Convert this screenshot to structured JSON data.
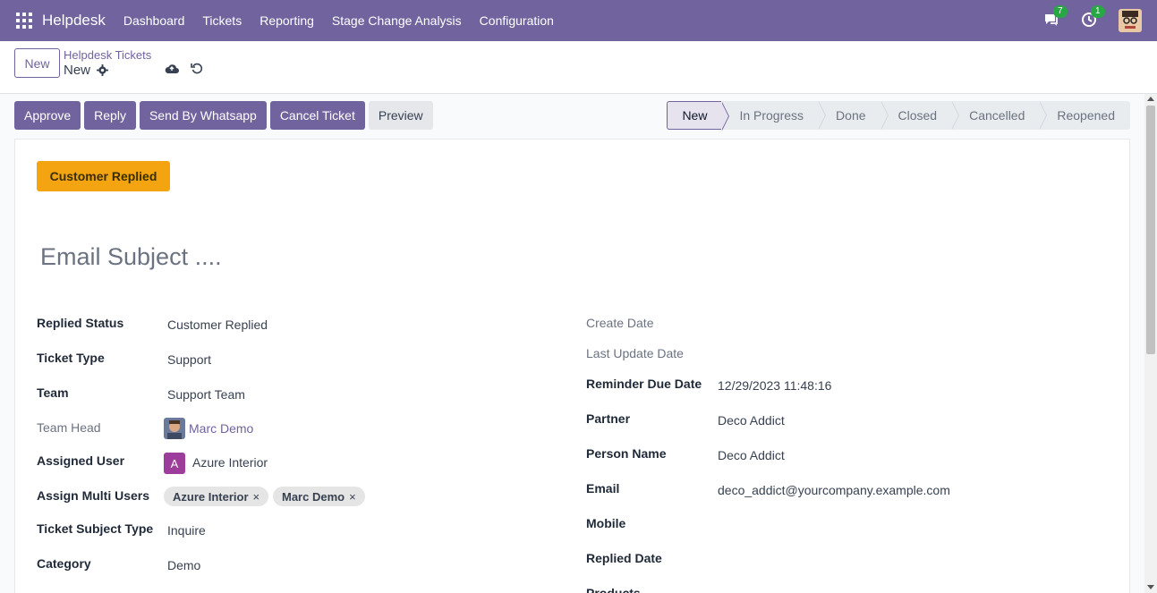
{
  "navbar": {
    "brand": "Helpdesk",
    "menu": [
      "Dashboard",
      "Tickets",
      "Reporting",
      "Stage Change Analysis",
      "Configuration"
    ],
    "messages_count": "7",
    "activities_count": "1",
    "accent_color": "#71639e"
  },
  "control": {
    "new_button": "New",
    "breadcrumb_parent": "Helpdesk Tickets",
    "breadcrumb_current": "New"
  },
  "statusbar": {
    "buttons": [
      "Approve",
      "Reply",
      "Send By Whatsapp",
      "Cancel Ticket",
      "Preview"
    ],
    "stages": [
      "New",
      "In Progress",
      "Done",
      "Closed",
      "Cancelled",
      "Reopened"
    ],
    "active_stage": "New"
  },
  "form": {
    "replied_badge": "Customer Replied",
    "subject_placeholder": "Email Subject ....",
    "left": {
      "replied_status": {
        "label": "Replied Status",
        "value": "Customer Replied"
      },
      "ticket_type": {
        "label": "Ticket Type",
        "value": "Support"
      },
      "team": {
        "label": "Team",
        "value": "Support Team"
      },
      "team_head": {
        "label": "Team Head",
        "value": "Marc Demo"
      },
      "assigned_user": {
        "label": "Assigned User",
        "value": "Azure Interior",
        "avatar_letter": "A"
      },
      "assign_multi_users": {
        "label": "Assign Multi Users",
        "tags": [
          "Azure Interior",
          "Marc Demo"
        ]
      },
      "ticket_subject_type": {
        "label": "Ticket Subject Type",
        "value": "Inquire"
      },
      "category": {
        "label": "Category",
        "value": "Demo"
      }
    },
    "right": {
      "create_date": {
        "label": "Create Date",
        "value": ""
      },
      "last_update_date": {
        "label": "Last Update Date",
        "value": ""
      },
      "reminder_due_date": {
        "label": "Reminder Due Date",
        "value": "12/29/2023 11:48:16"
      },
      "partner": {
        "label": "Partner",
        "value": "Deco Addict"
      },
      "person_name": {
        "label": "Person Name",
        "value": "Deco Addict"
      },
      "email": {
        "label": "Email",
        "value": "deco_addict@yourcompany.example.com"
      },
      "mobile": {
        "label": "Mobile",
        "value": ""
      },
      "replied_date": {
        "label": "Replied Date",
        "value": ""
      },
      "products": {
        "label": "Products",
        "value": ""
      }
    }
  }
}
